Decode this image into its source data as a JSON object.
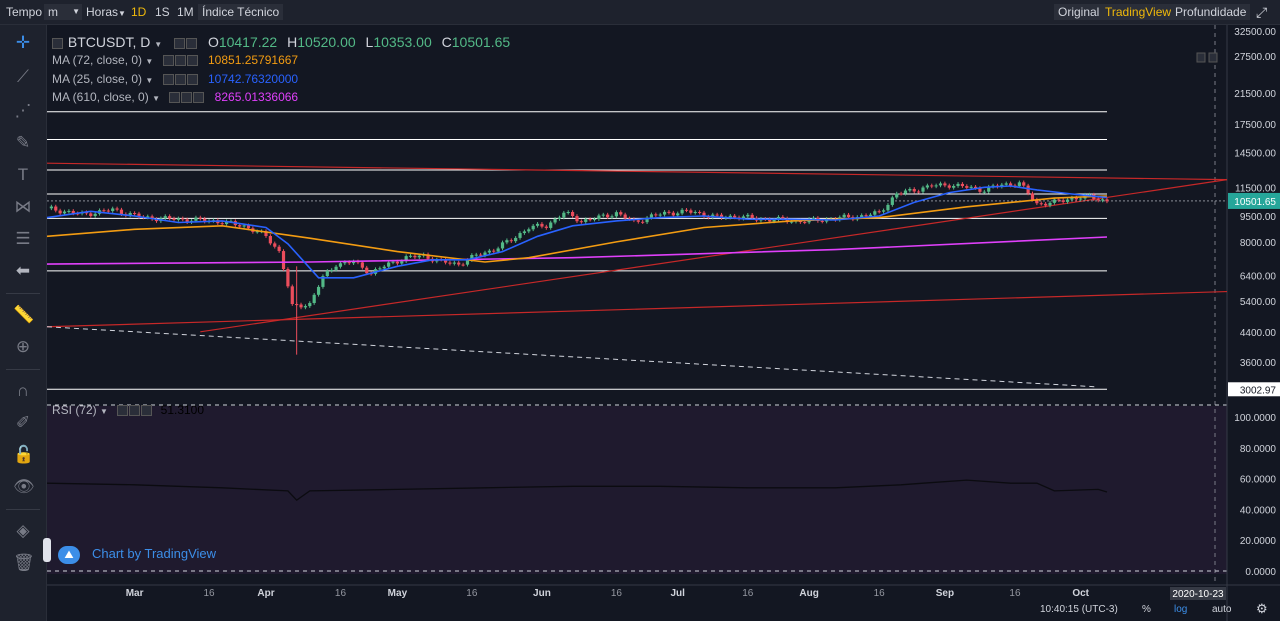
{
  "toolbar": {
    "tempo": "Tempo",
    "interval_value": "m",
    "horas": "Horas",
    "intervals": [
      "1D",
      "1S",
      "1M"
    ],
    "indicators": "Índice Técnico",
    "views": [
      "Original",
      "TradingView",
      "Profundidade"
    ],
    "active_view": "TradingView"
  },
  "legend": {
    "symbol": "BTCUSDT, D",
    "ohlc": {
      "o_label": "O",
      "o": "10417.22",
      "h_label": "H",
      "h": "10520.00",
      "l_label": "L",
      "l": "10353.00",
      "c_label": "C",
      "c": "10501.65"
    },
    "ma": [
      {
        "label": "MA (72, close, 0)",
        "value": "10851.25791667",
        "color": "#f39c12"
      },
      {
        "label": "MA (25, close, 0)",
        "value": "10742.76320000",
        "color": "#2962ff"
      },
      {
        "label": "MA (610, close, 0)",
        "value": "8265.01336066",
        "color": "#e040fb"
      }
    ],
    "rsi_label": "RSI (72)",
    "rsi_value": "51.3100"
  },
  "watermark": "Chart by TradingView",
  "bottom": {
    "time": "10:40:15 (UTC-3)",
    "percent": "%",
    "log": "log",
    "auto": "auto",
    "cursor_date": "2020-10-23"
  },
  "colors": {
    "up": "#53b987",
    "down": "#eb4d5c",
    "ma72": "#f39c12",
    "ma25": "#2962ff",
    "ma610": "#e040fb",
    "trend": "#c62828",
    "bg": "#131722",
    "rsi_bg": "#1f1a2e"
  },
  "chart_data": [
    {
      "type": "candlestick",
      "title": "BTCUSDT, D",
      "scale": "log",
      "x_tick_labels": [
        "Mar",
        "16",
        "Apr",
        "16",
        "May",
        "16",
        "Jun",
        "16",
        "Jul",
        "16",
        "Aug",
        "16",
        "Sep",
        "16",
        "Oct"
      ],
      "y_tick_labels": [
        "32500.00",
        "27500.00",
        "21500.00",
        "17500.00",
        "14500.00",
        "11500.00",
        "9500.00",
        "8000.00",
        "6400.00",
        "5400.00",
        "4400.00",
        "3600.00"
      ],
      "price_labels": {
        "last": "10501.65",
        "low_line": "3002.97"
      },
      "ohlc_last": {
        "open": 10417.22,
        "high": 10520.0,
        "low": 10353.0,
        "close": 10501.65
      },
      "ma_last": {
        "ma72": 10851.25791667,
        "ma25": 10742.7632,
        "ma610": 8265.01336066
      },
      "horizontal_levels": [
        19000,
        15800,
        12900,
        11000,
        9350,
        6600,
        3002.97
      ],
      "close_path": [
        [
          0,
          10000
        ],
        [
          8,
          9600
        ],
        [
          15,
          9900
        ],
        [
          22,
          9400
        ],
        [
          30,
          9300
        ],
        [
          38,
          9200
        ],
        [
          45,
          8900
        ],
        [
          50,
          8300
        ],
        [
          53,
          7500
        ],
        [
          56,
          5200
        ],
        [
          60,
          5300
        ],
        [
          63,
          6300
        ],
        [
          66,
          6900
        ],
        [
          70,
          7000
        ],
        [
          74,
          6500
        ],
        [
          78,
          6900
        ],
        [
          82,
          7200
        ],
        [
          86,
          7300
        ],
        [
          90,
          7000
        ],
        [
          94,
          6900
        ],
        [
          98,
          7300
        ],
        [
          102,
          7600
        ],
        [
          106,
          8100
        ],
        [
          110,
          8800
        ],
        [
          114,
          8900
        ],
        [
          118,
          9700
        ],
        [
          122,
          9200
        ],
        [
          126,
          9400
        ],
        [
          130,
          9700
        ],
        [
          134,
          9100
        ],
        [
          138,
          9500
        ],
        [
          142,
          9700
        ],
        [
          146,
          9800
        ],
        [
          150,
          9600
        ],
        [
          154,
          9400
        ],
        [
          158,
          9500
        ],
        [
          162,
          9300
        ],
        [
          166,
          9300
        ],
        [
          170,
          9200
        ],
        [
          174,
          9200
        ],
        [
          178,
          9300
        ],
        [
          182,
          9400
        ],
        [
          186,
          9500
        ],
        [
          190,
          9700
        ],
        [
          194,
          11000
        ],
        [
          198,
          11300
        ],
        [
          202,
          11600
        ],
        [
          206,
          11700
        ],
        [
          210,
          11500
        ],
        [
          214,
          11300
        ],
        [
          218,
          11700
        ],
        [
          222,
          11800
        ],
        [
          226,
          10300
        ],
        [
          230,
          10400
        ],
        [
          234,
          10700
        ],
        [
          238,
          10800
        ],
        [
          242,
          10500
        ]
      ],
      "ma25_path": [
        [
          0,
          9400
        ],
        [
          10,
          9800
        ],
        [
          20,
          9500
        ],
        [
          30,
          9100
        ],
        [
          40,
          9200
        ],
        [
          50,
          8800
        ],
        [
          55,
          7900
        ],
        [
          62,
          6300
        ],
        [
          70,
          6300
        ],
        [
          80,
          6800
        ],
        [
          88,
          7100
        ],
        [
          96,
          7100
        ],
        [
          104,
          7500
        ],
        [
          112,
          8300
        ],
        [
          120,
          8900
        ],
        [
          130,
          9200
        ],
        [
          140,
          9400
        ],
        [
          150,
          9500
        ],
        [
          160,
          9300
        ],
        [
          170,
          9300
        ],
        [
          180,
          9250
        ],
        [
          190,
          9500
        ],
        [
          198,
          10400
        ],
        [
          206,
          11100
        ],
        [
          214,
          11500
        ],
        [
          220,
          11600
        ],
        [
          226,
          11300
        ],
        [
          234,
          11000
        ],
        [
          240,
          10800
        ],
        [
          242,
          10742
        ]
      ],
      "ma72_path": [
        [
          0,
          8300
        ],
        [
          20,
          8700
        ],
        [
          40,
          8900
        ],
        [
          60,
          8200
        ],
        [
          80,
          7500
        ],
        [
          100,
          7000
        ],
        [
          110,
          7200
        ],
        [
          130,
          8000
        ],
        [
          150,
          8800
        ],
        [
          170,
          9200
        ],
        [
          190,
          9400
        ],
        [
          210,
          10100
        ],
        [
          230,
          10700
        ],
        [
          242,
          10851
        ]
      ],
      "ma610_path": [
        [
          0,
          6900
        ],
        [
          60,
          7000
        ],
        [
          120,
          7200
        ],
        [
          180,
          7600
        ],
        [
          242,
          8265
        ]
      ]
    },
    {
      "type": "line",
      "title": "RSI (72)",
      "y_tick_labels": [
        "100.0000",
        "80.0000",
        "60.0000",
        "40.0000",
        "20.0000",
        "0.0000"
      ],
      "ylim": [
        0,
        100
      ],
      "x": [
        0,
        20,
        40,
        55,
        57,
        60,
        80,
        100,
        120,
        140,
        160,
        180,
        195,
        200,
        210,
        220,
        226,
        230,
        240,
        242
      ],
      "values": [
        57,
        56,
        54,
        52,
        46,
        52,
        53,
        54,
        55,
        55,
        54,
        54,
        56,
        57,
        59,
        57,
        57,
        52,
        53,
        51.31
      ]
    }
  ]
}
